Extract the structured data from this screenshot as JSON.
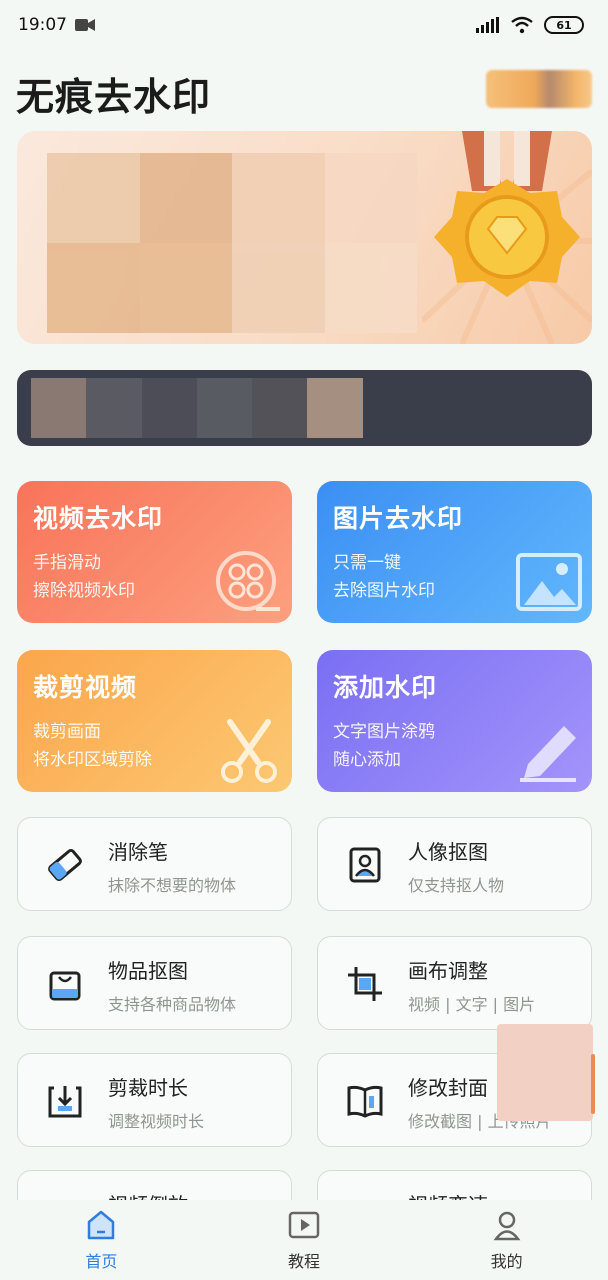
{
  "status_bar": {
    "time": "19:07",
    "battery": "61",
    "icons": [
      "video-record-icon",
      "signal-icon",
      "wifi-icon",
      "battery-icon"
    ]
  },
  "header": {
    "title": "无痕去水印"
  },
  "feature_cards": [
    {
      "title": "视频去水印",
      "line1": "手指滑动",
      "line2": "擦除视频水印",
      "icon": "film-reel-icon",
      "color_from": "#f9735a",
      "color_to": "#fca07e"
    },
    {
      "title": "图片去水印",
      "line1": "只需一键",
      "line2": "去除图片水印",
      "icon": "picture-icon",
      "color_from": "#3b8ff3",
      "color_to": "#62b7fd"
    },
    {
      "title": "裁剪视频",
      "line1": "裁剪画面",
      "line2": "将水印区域剪除",
      "icon": "scissors-icon",
      "color_from": "#fba64c",
      "color_to": "#fcc872"
    },
    {
      "title": "添加水印",
      "line1": "文字图片涂鸦",
      "line2": "随心添加",
      "icon": "pen-icon",
      "color_from": "#7a6ff3",
      "color_to": "#a394fb"
    }
  ],
  "tools": [
    {
      "title": "消除笔",
      "subtitle": "抹除不想要的物体",
      "icon": "eraser-icon"
    },
    {
      "title": "人像抠图",
      "subtitle": "仅支持抠人物",
      "icon": "portrait-icon"
    },
    {
      "title": "物品抠图",
      "subtitle": "支持各种商品物体",
      "icon": "bag-icon"
    },
    {
      "title": "画布调整",
      "subtitle": "视频 | 文字 | 图片",
      "icon": "crop-icon"
    },
    {
      "title": "剪裁时长",
      "subtitle": "调整视频时长",
      "icon": "download-box-icon"
    },
    {
      "title": "修改封面",
      "subtitle": "修改截图 | 上传照片",
      "icon": "book-icon"
    },
    {
      "title": "视频倒放",
      "subtitle": "",
      "icon": "reverse-icon"
    },
    {
      "title": "视频变速",
      "subtitle": "",
      "icon": "speed-icon"
    }
  ],
  "tab_bar": {
    "tabs": [
      {
        "label": "首页",
        "icon": "home-icon",
        "active": true
      },
      {
        "label": "教程",
        "icon": "video-play-icon",
        "active": false
      },
      {
        "label": "我的",
        "icon": "user-icon",
        "active": false
      }
    ],
    "active_color": "#2f7de0"
  }
}
